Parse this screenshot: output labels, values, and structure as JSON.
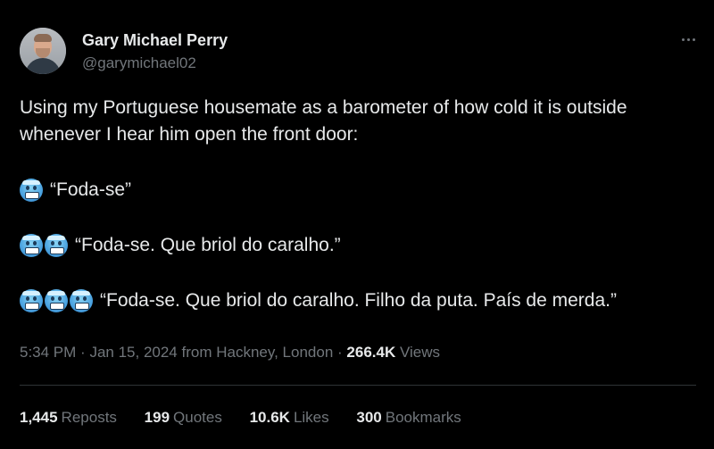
{
  "author": {
    "display_name": "Gary Michael Perry",
    "handle": "@garymichael02"
  },
  "tweet": {
    "line1": "Using my Portuguese housemate as a barometer of how cold it is outside",
    "line2": "whenever I hear him open the front door:",
    "quote1": "“Foda-se”",
    "quote2": "“Foda-se. Que briol do caralho.”",
    "quote3": "“Foda-se. Que briol do caralho. Filho da puta. País de merda.”",
    "emoji": "cold-face-emoji"
  },
  "meta": {
    "time": "5:34 PM",
    "sep1": "·",
    "date": "Jan 15, 2024",
    "location": "from Hackney, London",
    "sep2": "·",
    "views_count": "266.4K",
    "views_label": "Views"
  },
  "stats": {
    "reposts_count": "1,445",
    "reposts_label": "Reposts",
    "quotes_count": "199",
    "quotes_label": "Quotes",
    "likes_count": "10.6K",
    "likes_label": "Likes",
    "bookmarks_count": "300",
    "bookmarks_label": "Bookmarks"
  },
  "icons": {
    "more": "more-options-icon"
  }
}
